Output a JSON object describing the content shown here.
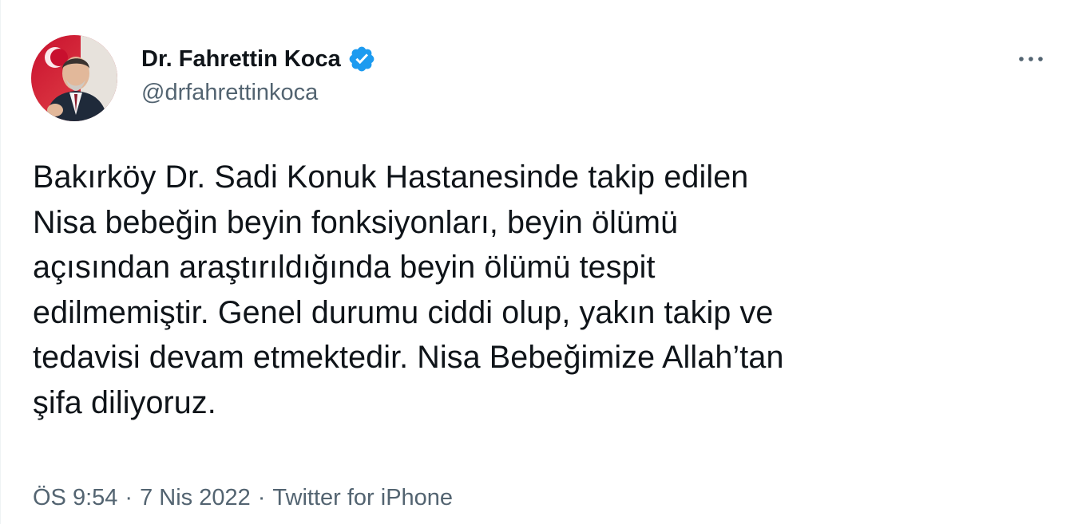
{
  "author": {
    "display_name": "Dr. Fahrettin Koca",
    "handle": "@drfahrettinkoca",
    "verified": true,
    "avatar_icon": "profile-photo"
  },
  "more_icon": "more-horizontal-icon",
  "tweet": {
    "text": "Bakırköy Dr. Sadi Konuk Hastanesinde takip edilen\nNisa bebeğin beyin fonksiyonları, beyin ölümü\naçısından araştırıldığında beyin ölümü tespit\nedilmemiştir. Genel durumu ciddi olup, yakın takip ve\ntedavisi devam etmektedir. Nisa Bebeğimize Allah’tan\nşifa diliyoruz."
  },
  "meta": {
    "time": "ÖS 9:54",
    "date": "7 Nis 2022",
    "separator": "·",
    "source": "Twitter for iPhone"
  },
  "colors": {
    "text": "#0f1419",
    "secondary": "#536471",
    "verified": "#1d9bf0",
    "border": "#eff3f4"
  }
}
